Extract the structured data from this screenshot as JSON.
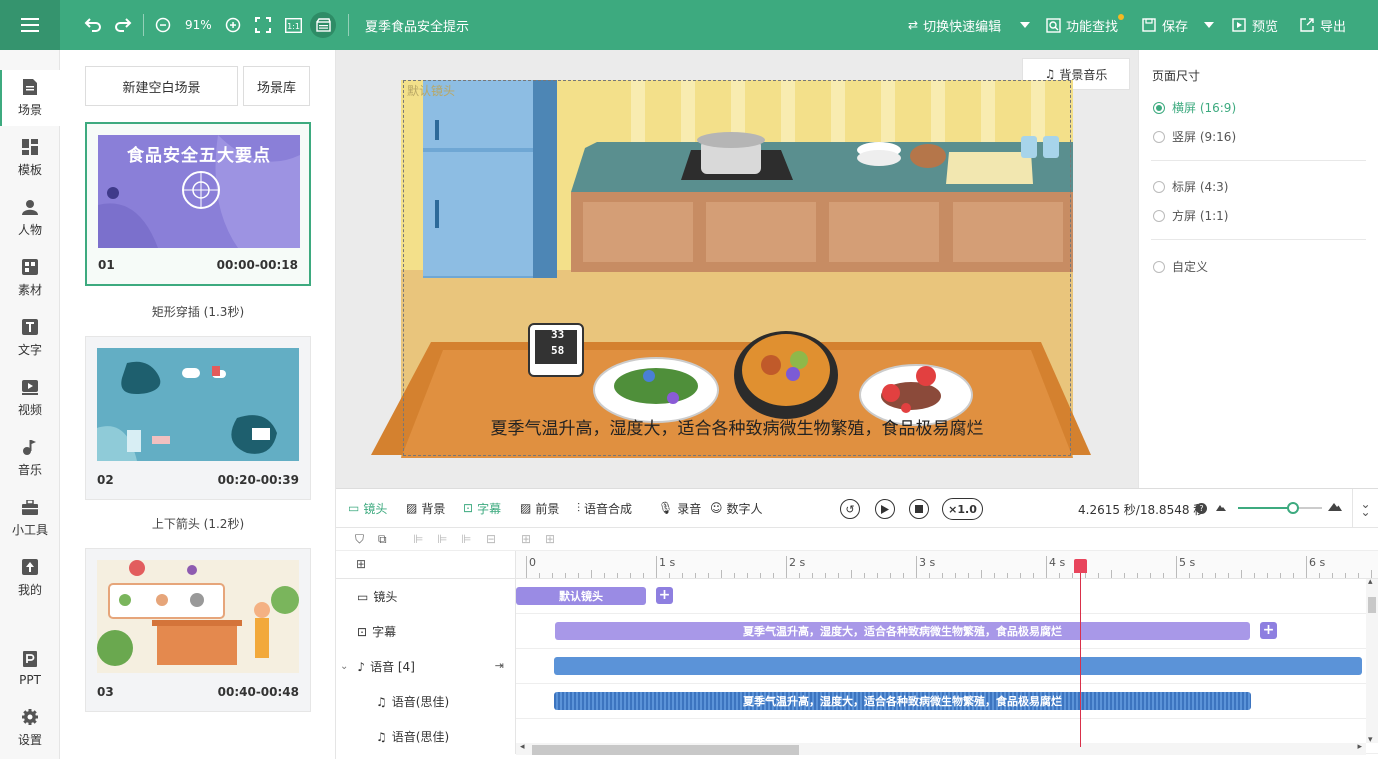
{
  "header": {
    "zoom": "91%",
    "title": "夏季食品安全提示",
    "switch_edit": "切换快速编辑",
    "func_search": "功能查找",
    "save": "保存",
    "preview": "预览",
    "export": "导出"
  },
  "left_nav": [
    {
      "label": "场景",
      "icon": "scene-icon"
    },
    {
      "label": "模板",
      "icon": "template-icon"
    },
    {
      "label": "人物",
      "icon": "person-icon"
    },
    {
      "label": "素材",
      "icon": "material-icon"
    },
    {
      "label": "文字",
      "icon": "text-icon"
    },
    {
      "label": "视频",
      "icon": "video-icon"
    },
    {
      "label": "音乐",
      "icon": "music-icon"
    },
    {
      "label": "小工具",
      "icon": "toolbox-icon"
    },
    {
      "label": "我的",
      "icon": "mine-icon"
    },
    {
      "label": "PPT",
      "icon": "ppt-icon"
    },
    {
      "label": "设置",
      "icon": "settings-icon"
    }
  ],
  "scene_panel": {
    "new_blank": "新建空白场景",
    "library": "场景库",
    "scenes": [
      {
        "num": "01",
        "time": "00:00-00:18",
        "thumb_title": "食品安全五大要点"
      },
      {
        "num": "02",
        "time": "00:20-00:39"
      },
      {
        "num": "03",
        "time": "00:40-00:48"
      }
    ],
    "transitions": [
      "矩形穿插 (1.3秒)",
      "上下箭头 (1.2秒)"
    ]
  },
  "canvas": {
    "bg_music": "背景音乐",
    "default_camera": "默认镜头",
    "subtitle": "夏季气温升高，湿度大，适合各种致病微生物繁殖，食品极易腐烂",
    "thermo_top": "33",
    "thermo_bottom": "58"
  },
  "right_panel": {
    "title": "页面尺寸",
    "options": [
      "横屏 (16:9)",
      "竖屏 (9:16)",
      "标屏 (4:3)",
      "方屏 (1:1)",
      "自定义"
    ],
    "selected": "横屏 (16:9)"
  },
  "timeline": {
    "tabs": [
      "镜头",
      "背景",
      "字幕",
      "前景",
      "语音合成",
      "录音",
      "数字人"
    ],
    "speed": "×1.0",
    "time_display": "4.2615 秒/18.8548 秒",
    "ruler": [
      "0",
      "1 s",
      "2 s",
      "3 s",
      "4 s",
      "5 s",
      "6 s"
    ],
    "rows": [
      {
        "label": "镜头",
        "clip": "默认镜头"
      },
      {
        "label": "字幕",
        "clip": "夏季气温升高，湿度大，适合各种致病微生物繁殖，食品极易腐烂"
      },
      {
        "label": "语音 [4]",
        "clip": ""
      },
      {
        "label": "语音(思佳)",
        "clip": "夏季气温升高，湿度大，适合各种致病微生物繁殖，食品极易腐烂"
      },
      {
        "label": "语音(思佳)",
        "clip": ""
      }
    ],
    "playhead_seconds": 4.2615,
    "zoom_level": 0.6
  },
  "colors": {
    "accent": "#3daa7f",
    "clip_purple": "#a898e8",
    "clip_blue": "#5b93d8",
    "playhead": "#d9304a"
  }
}
